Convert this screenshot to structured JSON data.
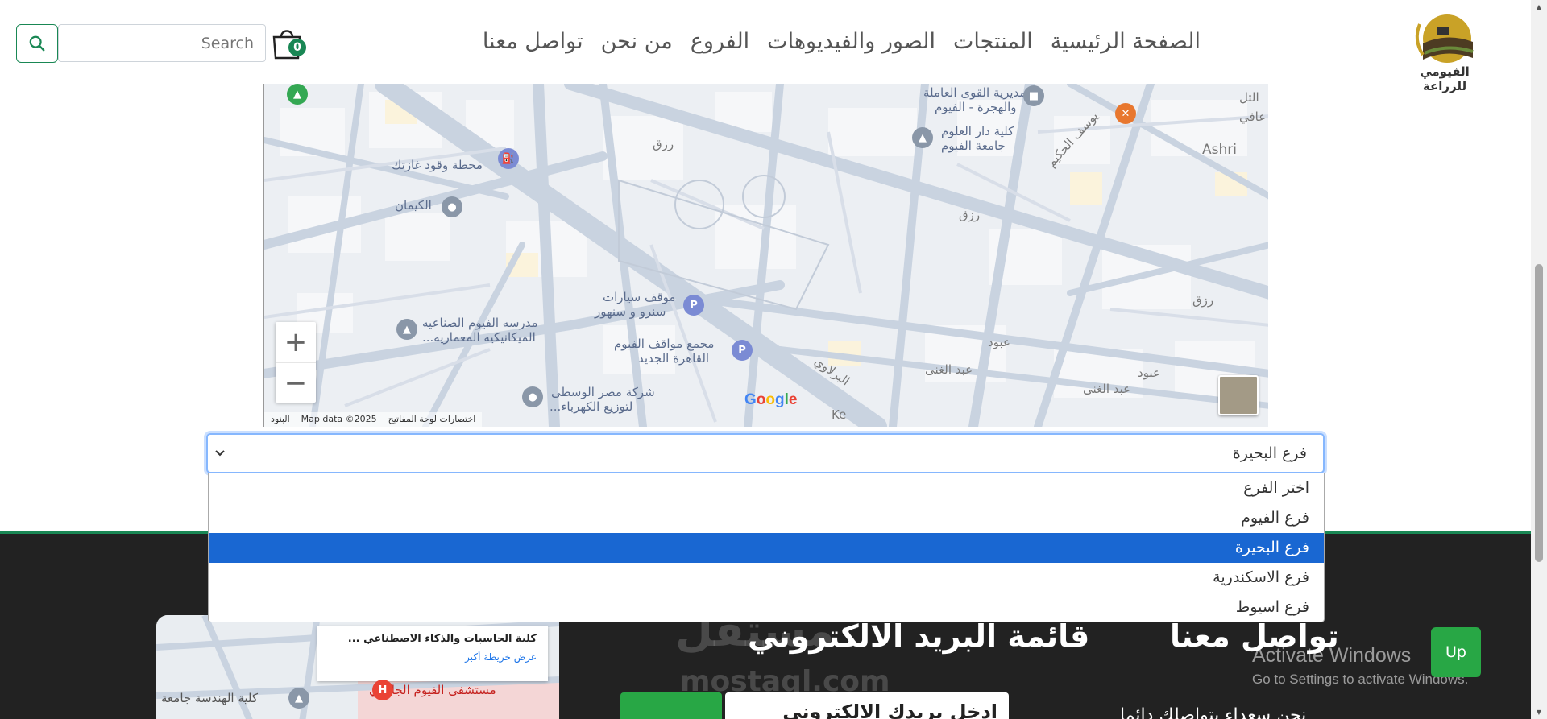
{
  "header": {
    "search_placeholder": "Search",
    "cart_count": "0",
    "nav": [
      "الصفحة الرئيسية",
      "المنتجات",
      "الصور والفيديوهات",
      "الفروع",
      "من نحن",
      "تواصل معنا"
    ],
    "logo_text": "الفيومي للزراعة"
  },
  "map": {
    "labels": {
      "l1": "مديرية القوى العاملة",
      "l2": "والهجرة - الفيوم",
      "l3": "كلية دار العلوم",
      "l4": "جامعة الفيوم",
      "l5": "محطة وقود غازتك",
      "l6": "الكيمان",
      "l7": "موقف سيارات",
      "l8": "سنرو و سنهور",
      "l9": "مدرسه الفيوم الصناعيه",
      "l10": "الميكانيكيه المعماريه...",
      "l11": "مجمع مواقف الفيوم",
      "l12": "القاهرة الجديد",
      "l13": "شركة مصر الوسطى",
      "l14": "لتوزيع الكهرباء...",
      "l15": "رزق",
      "l16": "رزق",
      "l17": "رزق",
      "l18": "عبود",
      "l19": "عبد الغنى",
      "l20": "عبود",
      "l21": "عبد الغنى",
      "l22": "Ashri",
      "l23": "يوسف الحكيم",
      "l24": "التل",
      "l25": "عافي",
      "l26": "البرلاوي",
      "l27": "Ke"
    },
    "attr": {
      "terms": "البنود",
      "data": "Map data ©2025",
      "shortcuts": "اختصارات لوحة المفاتيح"
    },
    "google": "Google",
    "zoom_in": "+",
    "zoom_out": "−"
  },
  "branch_select": {
    "value": "فرع البحيرة",
    "options": [
      "اختر الفرع",
      "فرع الفيوم",
      "فرع البحيرة",
      "فرع الاسكندرية",
      "فرع اسيوط"
    ],
    "selected_index": 2
  },
  "footer": {
    "map_card_title": "كلية الحاسبات والذكاء الاصطناعي ...",
    "map_card_link": "عرض خريطة أكبر",
    "map_label1": "كلية الهندسة جامعة",
    "map_label2": "مستشفى الفيوم الجامعي",
    "newsletter_heading": "قائمة البريد الالكتروني",
    "contact_heading": "تواصل معنا",
    "email_placeholder": "ادخل بريدك الالكتروني",
    "contact_line": "نحن سعداء بتواصلك دائما",
    "up_button": "Up",
    "watermark": "مستقل",
    "watermark_latin": "mostaql.com",
    "win_title": "Activate Windows",
    "win_sub": "Go to Settings to activate Windows."
  },
  "colors": {
    "accent": "#198754",
    "select_highlight": "#1967d2",
    "footer_bg": "#222222",
    "up_button": "#28a745"
  }
}
